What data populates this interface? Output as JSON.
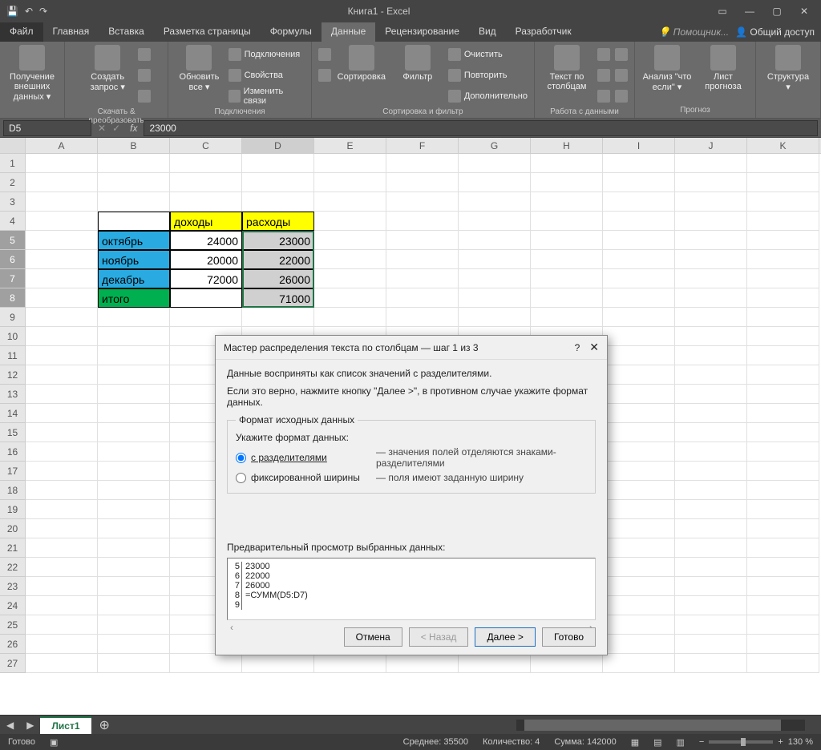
{
  "title": "Книга1 - Excel",
  "qat": {
    "save": "💾",
    "undo": "↶",
    "redo": "↷"
  },
  "win": {
    "min": "—",
    "maxopts": "▭",
    "close": "✕"
  },
  "tabs": {
    "file": "Файл",
    "home": "Главная",
    "insert": "Вставка",
    "pagelayout": "Разметка страницы",
    "formulas": "Формулы",
    "data": "Данные",
    "review": "Рецензирование",
    "view": "Вид",
    "developer": "Разработчик",
    "tell": "Помощник...",
    "share": "Общий доступ"
  },
  "ribbon": {
    "getdata": {
      "btn": "Получение\nвнешних данных ▾",
      "label": ""
    },
    "query": {
      "btn": "Создать\nзапрос ▾",
      "sub": "Скачать & преобразовать"
    },
    "refresh": {
      "btn": "Обновить\nвсе ▾",
      "c1": "Подключения",
      "c2": "Свойства",
      "c3": "Изменить связи",
      "label": "Подключения"
    },
    "sort": {
      "az": "A↓Z",
      "za": "Z↓A",
      "btn": "Сортировка"
    },
    "filter": {
      "btn": "Фильтр",
      "c1": "Очистить",
      "c2": "Повторить",
      "c3": "Дополнительно",
      "label": "Сортировка и фильтр"
    },
    "ttc": {
      "btn": "Текст по\nстолбцам",
      "label": "Работа с данными"
    },
    "whatif": {
      "btn": "Анализ \"что\nесли\" ▾"
    },
    "forecast": {
      "btn": "Лист\nпрогноза",
      "label": "Прогноз"
    },
    "outline": {
      "btn": "Структура\n▾"
    }
  },
  "namebox": "D5",
  "formula": "23000",
  "cols": [
    "A",
    "B",
    "C",
    "D",
    "E",
    "F",
    "G",
    "H",
    "I",
    "J",
    "K"
  ],
  "rowcount": 27,
  "cells": {
    "C4": "доходы",
    "D4": "расходы",
    "B5": "октябрь",
    "C5": "24000",
    "D5": "23000",
    "B6": "ноябрь",
    "C6": "20000",
    "D6": "22000",
    "B7": "декабрь",
    "C7": "72000",
    "D7": "26000",
    "B8": "итого",
    "D8": "71000"
  },
  "dialog": {
    "title": "Мастер распределения текста по столбцам — шаг 1 из 3",
    "p1": "Данные восприняты как список значений с разделителями.",
    "p2": "Если это верно, нажмите кнопку \"Далее >\", в противном случае укажите формат данных.",
    "fieldset": "Формат исходных данных",
    "hint": "Укажите формат данных:",
    "r1": "с разделителями",
    "r1d": "— значения полей отделяются знаками-разделителями",
    "r2": "фиксированной ширины",
    "r2d": "— поля имеют заданную ширину",
    "previewlbl": "Предварительный просмотр выбранных данных:",
    "preview": [
      {
        "n": "5",
        "v": "23000"
      },
      {
        "n": "6",
        "v": "22000"
      },
      {
        "n": "7",
        "v": "26000"
      },
      {
        "n": "8",
        "v": "=СУММ(D5:D7)"
      },
      {
        "n": "9",
        "v": ""
      }
    ],
    "cancel": "Отмена",
    "back": "< Назад",
    "next": "Далее >",
    "finish": "Готово"
  },
  "sheet": {
    "name": "Лист1"
  },
  "status": {
    "ready": "Готово",
    "avg": "Среднее: 35500",
    "count": "Количество: 4",
    "sum": "Сумма: 142000",
    "zoom": "130 %"
  }
}
